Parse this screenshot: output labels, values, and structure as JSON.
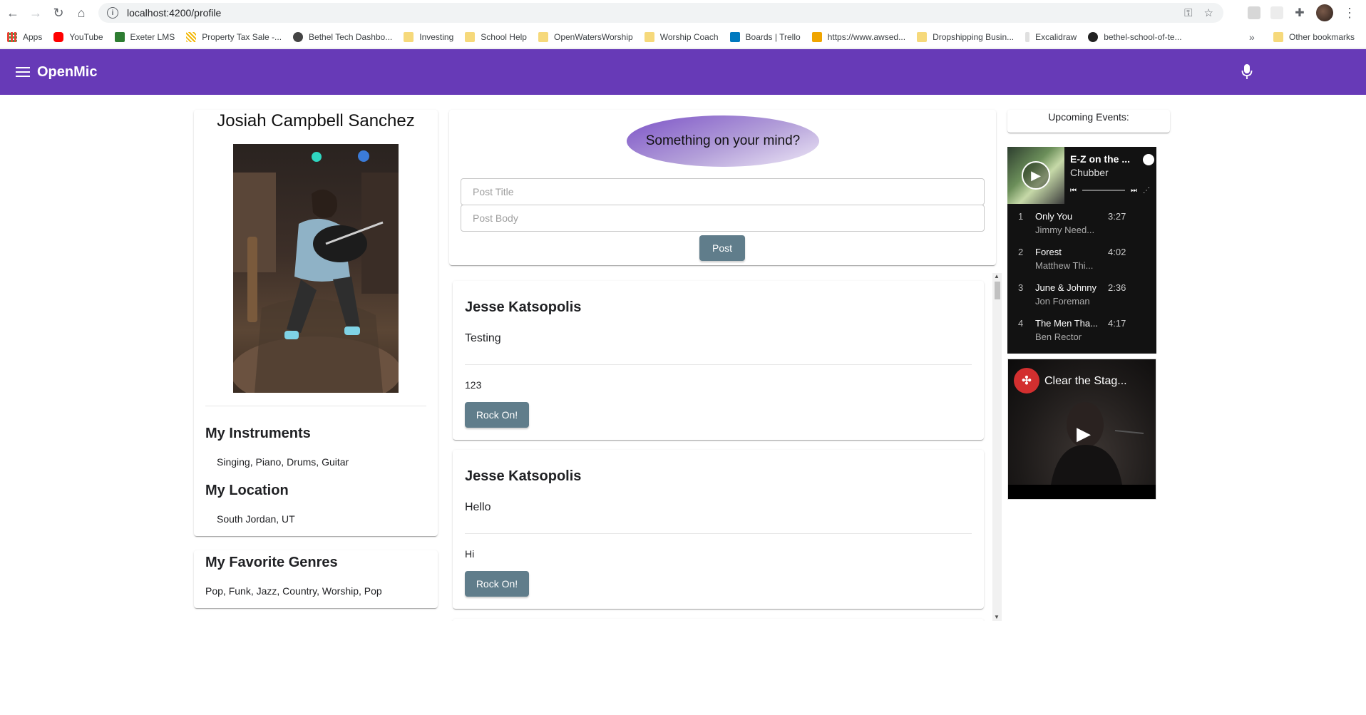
{
  "browser": {
    "url": "localhost:4200/profile",
    "bookmarks": [
      {
        "label": "Apps",
        "icon": "apps-grid-icon"
      },
      {
        "label": "YouTube",
        "icon": "youtube-icon"
      },
      {
        "label": "Exeter LMS",
        "icon": "exeter-icon"
      },
      {
        "label": "Property Tax Sale -...",
        "icon": "property-icon"
      },
      {
        "label": "Bethel Tech Dashbo...",
        "icon": "bethel-icon"
      },
      {
        "label": "Investing",
        "icon": "folder-icon"
      },
      {
        "label": "School Help",
        "icon": "folder-icon"
      },
      {
        "label": "OpenWatersWorship",
        "icon": "folder-icon"
      },
      {
        "label": "Worship Coach",
        "icon": "folder-icon"
      },
      {
        "label": "Boards | Trello",
        "icon": "trello-icon"
      },
      {
        "label": "https://www.awsed...",
        "icon": "box-icon"
      },
      {
        "label": "Dropshipping Busin...",
        "icon": "folder-icon"
      },
      {
        "label": "Excalidraw",
        "icon": "excalidraw-icon"
      },
      {
        "label": "bethel-school-of-te...",
        "icon": "github-icon"
      }
    ],
    "more_label": "»",
    "other_bookmarks": "Other bookmarks"
  },
  "app": {
    "title": "OpenMic"
  },
  "profile": {
    "name": "Josiah Campbell Sanchez",
    "instruments_heading": "My Instruments",
    "instruments": "Singing, Piano, Drums, Guitar",
    "location_heading": "My Location",
    "location": "South Jordan, UT",
    "genres_heading": "My Favorite Genres",
    "genres": "Pop, Funk, Jazz, Country, Worship, Pop"
  },
  "compose": {
    "prompt": "Something on your mind?",
    "title_placeholder": "Post Title",
    "body_placeholder": "Post Body",
    "post_label": "Post"
  },
  "posts": [
    {
      "author": "Jesse Katsopolis",
      "title": "Testing",
      "body": "123",
      "action": "Rock On!"
    },
    {
      "author": "Jesse Katsopolis",
      "title": "Hello",
      "body": "Hi",
      "action": "Rock On!"
    }
  ],
  "events": {
    "heading": "Upcoming Events:"
  },
  "spotify": {
    "album": "E-Z on the ...",
    "artist": "Chubber",
    "tracks": [
      {
        "num": "1",
        "name": "Only You",
        "artist": "Jimmy Need...",
        "dur": "3:27"
      },
      {
        "num": "2",
        "name": "Forest",
        "artist": "Matthew Thi...",
        "dur": "4:02"
      },
      {
        "num": "3",
        "name": "June & Johnny",
        "artist": "Jon Foreman",
        "dur": "2:36"
      },
      {
        "num": "4",
        "name": "The Men Tha...",
        "artist": "Ben Rector",
        "dur": "4:17"
      }
    ]
  },
  "youtube": {
    "title": "Clear the Stag..."
  },
  "colors": {
    "appbar": "#673ab7",
    "button": "#607d8b"
  }
}
